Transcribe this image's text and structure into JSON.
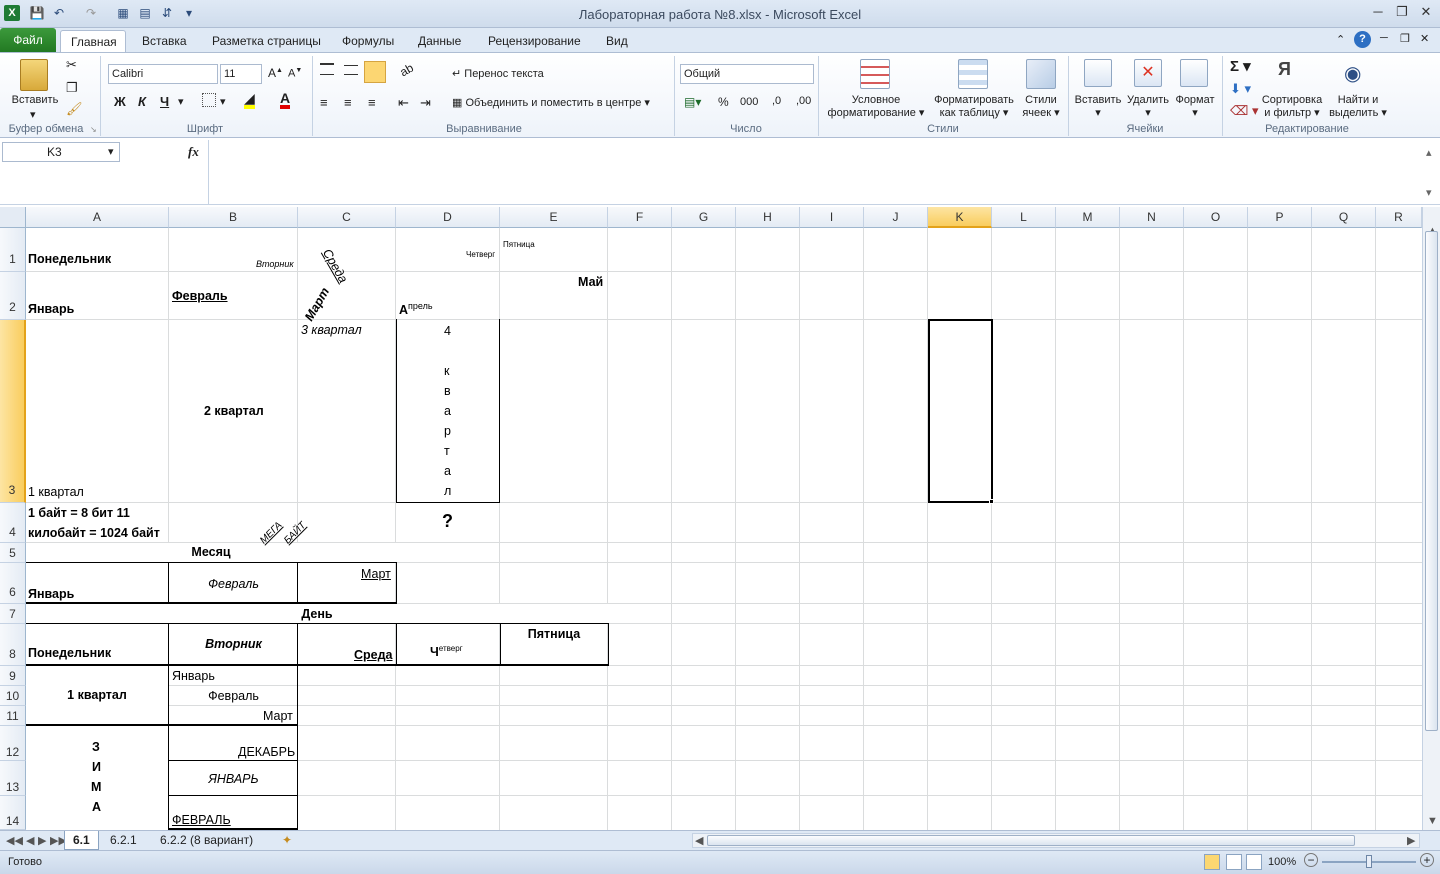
{
  "window": {
    "title": "Лабораторная работа №8.xlsx  -  Microsoft Excel"
  },
  "ribbon_tabs": [
    "Файл",
    "Главная",
    "Вставка",
    "Разметка страницы",
    "Формулы",
    "Данные",
    "Рецензирование",
    "Вид"
  ],
  "ribbon": {
    "clipboard": {
      "paste": "Вставить",
      "label": "Буфер обмена"
    },
    "font": {
      "name": "Calibri",
      "size": "11",
      "label": "Шрифт",
      "bold": "Ж",
      "italic": "К",
      "underline": "Ч"
    },
    "alignment": {
      "wrap": "Перенос текста",
      "merge": "Объединить и поместить в центре",
      "label": "Выравнивание"
    },
    "number": {
      "format": "Общий",
      "label": "Число",
      "percent": "%",
      "thousands": "000"
    },
    "styles": {
      "conditional": "Условное",
      "conditional2": "форматирование",
      "astable": "Форматировать",
      "astable2": "как таблицу",
      "cellstyles": "Стили",
      "cellstyles2": "ячеек",
      "label": "Стили"
    },
    "cells": {
      "insert": "Вставить",
      "delete": "Удалить",
      "format": "Формат",
      "label": "Ячейки"
    },
    "editing": {
      "sort": "Сортировка",
      "sort2": "и фильтр",
      "find": "Найти и",
      "find2": "выделить",
      "label": "Редактирование"
    }
  },
  "formula_bar": {
    "name_box": "K3",
    "fx": "fx",
    "formula": ""
  },
  "columns": [
    "A",
    "B",
    "C",
    "D",
    "E",
    "F",
    "G",
    "H",
    "I",
    "J",
    "K",
    "L",
    "M",
    "N",
    "O",
    "P",
    "Q",
    "R"
  ],
  "rows": [
    "1",
    "2",
    "3",
    "4",
    "5",
    "6",
    "7",
    "8",
    "9",
    "10",
    "11",
    "12",
    "13",
    "14"
  ],
  "cells": {
    "A1": "Понедельник",
    "B1": "Вторник",
    "C1": "Среда",
    "D1": "Четверг",
    "E1": "Пятница",
    "A2": "Январь",
    "B2": "Февраль",
    "C2": "Март",
    "D2a": "А",
    "D2b": "прель",
    "E2": "Май",
    "A3": "1 квартал",
    "B3": "2 квартал",
    "C3": "3 квартал",
    "D3": [
      "4",
      "",
      "к",
      "в",
      "а",
      "р",
      "т",
      "а",
      "л"
    ],
    "A4a": "1 байт = 8 бит  11",
    "A4b": "килобайт = 1024 байт",
    "B4a": "МЕГА",
    "B4b": "БАЙТ",
    "D4": "?",
    "A5": "Месяц",
    "A6": "Январь",
    "B6": "Февраль",
    "C6": "Март",
    "A7": "День",
    "A8": "Понедельник",
    "B8": "Вторник",
    "C8": "Среда",
    "D8a": "Ч",
    "D8b": "етверг",
    "E8": "Пятница",
    "A9": "1 квартал",
    "B9": "Январь",
    "B10": "Февраль",
    "B11": "Март",
    "A12": [
      "З",
      "И",
      "М",
      "А"
    ],
    "B12": "ДЕКАБРЬ",
    "B13": "ЯНВАРЬ",
    "B14": "ФЕВРАЛЬ"
  },
  "sheet_tabs": [
    "6.1",
    "6.2.1",
    "6.2.2 (8 вариант)"
  ],
  "status": {
    "ready": "Готово",
    "zoom": "100%"
  }
}
